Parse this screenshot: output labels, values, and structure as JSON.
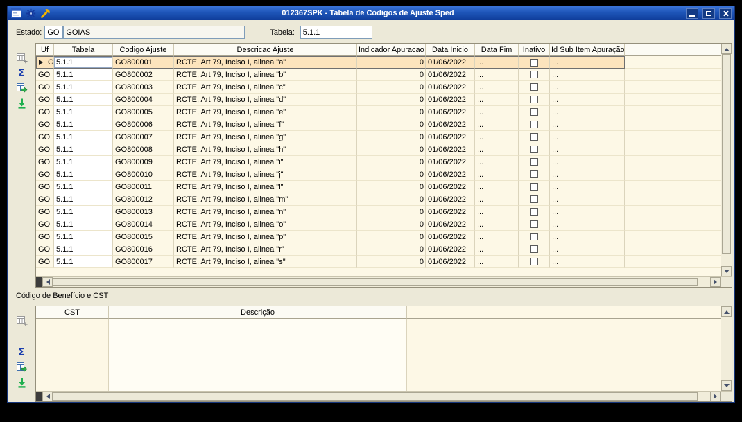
{
  "window": {
    "title": "012367SPK - Tabela de Códigos de Ajuste Sped"
  },
  "form": {
    "estado_label": "Estado:",
    "estado_uf": "GO",
    "estado_nome": "GOIAS",
    "tabela_label": "Tabela:",
    "tabela_valor": "5.1.1"
  },
  "icons": {
    "titlebar": [
      "form-icon",
      "components-icon",
      "wrench-icon"
    ],
    "grid_toolbar": [
      "add-record-icon",
      "sum-icon",
      "export-icon",
      "last-record-icon"
    ],
    "sum_glyph": "Σ"
  },
  "colors": {
    "titlebar_blue": "#1e55b8",
    "grid_background": "#fdf8e6",
    "selected_row": "#fce4bd"
  },
  "main_grid": {
    "columns": [
      "Uf",
      "Tabela",
      "Codigo Ajuste",
      "Descricao Ajuste",
      "Indicador Apuracao",
      "Data Inicio",
      "Data Fim",
      "Inativo",
      "Id Sub Item Apuração"
    ],
    "selected_row": 0,
    "rows": [
      {
        "uf": "GO",
        "tabela": "5.1.1",
        "codigo_ajuste": "GO800001",
        "descricao_ajuste": "RCTE, Art 79, Inciso I, alinea \"a\"",
        "indicador_apuracao": "0",
        "data_inicio": "01/06/2022",
        "data_fim": "...",
        "inativo": false,
        "id_sub_item_apuracao": "..."
      },
      {
        "uf": "GO",
        "tabela": "5.1.1",
        "codigo_ajuste": "GO800002",
        "descricao_ajuste": "RCTE, Art 79, Inciso I, alinea \"b\"",
        "indicador_apuracao": "0",
        "data_inicio": "01/06/2022",
        "data_fim": "...",
        "inativo": false,
        "id_sub_item_apuracao": "..."
      },
      {
        "uf": "GO",
        "tabela": "5.1.1",
        "codigo_ajuste": "GO800003",
        "descricao_ajuste": "RCTE, Art 79, Inciso I, alinea \"c\"",
        "indicador_apuracao": "0",
        "data_inicio": "01/06/2022",
        "data_fim": "...",
        "inativo": false,
        "id_sub_item_apuracao": "..."
      },
      {
        "uf": "GO",
        "tabela": "5.1.1",
        "codigo_ajuste": "GO800004",
        "descricao_ajuste": "RCTE, Art 79, Inciso I, alinea \"d\"",
        "indicador_apuracao": "0",
        "data_inicio": "01/06/2022",
        "data_fim": "...",
        "inativo": false,
        "id_sub_item_apuracao": "..."
      },
      {
        "uf": "GO",
        "tabela": "5.1.1",
        "codigo_ajuste": "GO800005",
        "descricao_ajuste": "RCTE, Art 79, Inciso I, alinea \"e\"",
        "indicador_apuracao": "0",
        "data_inicio": "01/06/2022",
        "data_fim": "...",
        "inativo": false,
        "id_sub_item_apuracao": "..."
      },
      {
        "uf": "GO",
        "tabela": "5.1.1",
        "codigo_ajuste": "GO800006",
        "descricao_ajuste": "RCTE, Art 79, Inciso I, alinea \"f\"",
        "indicador_apuracao": "0",
        "data_inicio": "01/06/2022",
        "data_fim": "...",
        "inativo": false,
        "id_sub_item_apuracao": "..."
      },
      {
        "uf": "GO",
        "tabela": "5.1.1",
        "codigo_ajuste": "GO800007",
        "descricao_ajuste": "RCTE, Art 79, Inciso I, alinea \"g\"",
        "indicador_apuracao": "0",
        "data_inicio": "01/06/2022",
        "data_fim": "...",
        "inativo": false,
        "id_sub_item_apuracao": "..."
      },
      {
        "uf": "GO",
        "tabela": "5.1.1",
        "codigo_ajuste": "GO800008",
        "descricao_ajuste": "RCTE, Art 79, Inciso I, alinea \"h\"",
        "indicador_apuracao": "0",
        "data_inicio": "01/06/2022",
        "data_fim": "...",
        "inativo": false,
        "id_sub_item_apuracao": "..."
      },
      {
        "uf": "GO",
        "tabela": "5.1.1",
        "codigo_ajuste": "GO800009",
        "descricao_ajuste": "RCTE, Art 79, Inciso I, alinea \"i\"",
        "indicador_apuracao": "0",
        "data_inicio": "01/06/2022",
        "data_fim": "...",
        "inativo": false,
        "id_sub_item_apuracao": "..."
      },
      {
        "uf": "GO",
        "tabela": "5.1.1",
        "codigo_ajuste": "GO800010",
        "descricao_ajuste": "RCTE, Art 79, Inciso I, alinea \"j\"",
        "indicador_apuracao": "0",
        "data_inicio": "01/06/2022",
        "data_fim": "...",
        "inativo": false,
        "id_sub_item_apuracao": "..."
      },
      {
        "uf": "GO",
        "tabela": "5.1.1",
        "codigo_ajuste": "GO800011",
        "descricao_ajuste": "RCTE, Art 79, Inciso I, alinea \"l\"",
        "indicador_apuracao": "0",
        "data_inicio": "01/06/2022",
        "data_fim": "...",
        "inativo": false,
        "id_sub_item_apuracao": "..."
      },
      {
        "uf": "GO",
        "tabela": "5.1.1",
        "codigo_ajuste": "GO800012",
        "descricao_ajuste": "RCTE, Art 79, Inciso I, alinea \"m\"",
        "indicador_apuracao": "0",
        "data_inicio": "01/06/2022",
        "data_fim": "...",
        "inativo": false,
        "id_sub_item_apuracao": "..."
      },
      {
        "uf": "GO",
        "tabela": "5.1.1",
        "codigo_ajuste": "GO800013",
        "descricao_ajuste": "RCTE, Art 79, Inciso I, alinea \"n\"",
        "indicador_apuracao": "0",
        "data_inicio": "01/06/2022",
        "data_fim": "...",
        "inativo": false,
        "id_sub_item_apuracao": "..."
      },
      {
        "uf": "GO",
        "tabela": "5.1.1",
        "codigo_ajuste": "GO800014",
        "descricao_ajuste": "RCTE, Art 79, Inciso I, alinea \"o\"",
        "indicador_apuracao": "0",
        "data_inicio": "01/06/2022",
        "data_fim": "...",
        "inativo": false,
        "id_sub_item_apuracao": "..."
      },
      {
        "uf": "GO",
        "tabela": "5.1.1",
        "codigo_ajuste": "GO800015",
        "descricao_ajuste": "RCTE, Art 79, Inciso I, alinea \"p\"",
        "indicador_apuracao": "0",
        "data_inicio": "01/06/2022",
        "data_fim": "...",
        "inativo": false,
        "id_sub_item_apuracao": "..."
      },
      {
        "uf": "GO",
        "tabela": "5.1.1",
        "codigo_ajuste": "GO800016",
        "descricao_ajuste": "RCTE, Art 79, Inciso I, alinea \"r\"",
        "indicador_apuracao": "0",
        "data_inicio": "01/06/2022",
        "data_fim": "...",
        "inativo": false,
        "id_sub_item_apuracao": "..."
      },
      {
        "uf": "GO",
        "tabela": "5.1.1",
        "codigo_ajuste": "GO800017",
        "descricao_ajuste": "RCTE, Art 79, Inciso I, alinea \"s\"",
        "indicador_apuracao": "0",
        "data_inicio": "01/06/2022",
        "data_fim": "...",
        "inativo": false,
        "id_sub_item_apuracao": "..."
      }
    ]
  },
  "cst_section": {
    "title": "Código de Benefício e CST",
    "columns": [
      "CST",
      "Descrição"
    ],
    "rows": []
  }
}
